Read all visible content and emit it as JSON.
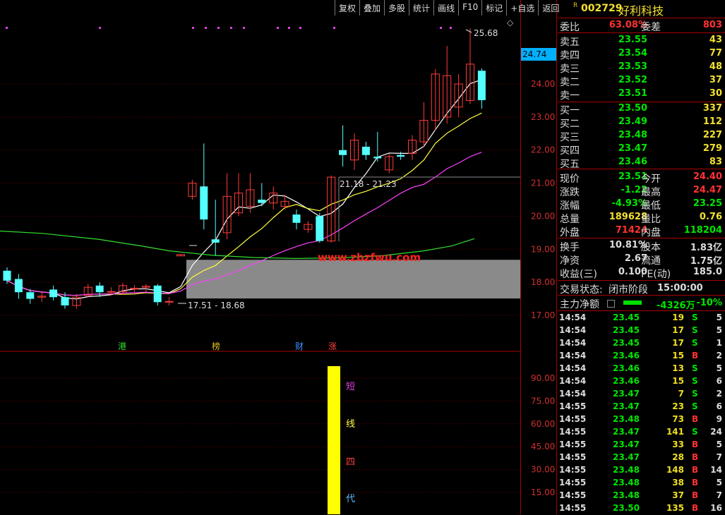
{
  "toolbar": {
    "items": [
      "复权",
      "叠加",
      "多股",
      "统计",
      "画线",
      "F10",
      "标记",
      "+自选",
      "返回"
    ]
  },
  "symbol": {
    "r_mark": "R",
    "code": "002729",
    "name": "好利科技"
  },
  "orderbook": {
    "weibi_label": "委比",
    "weibi_value": "63.08%",
    "weicha_label": "委差",
    "weicha_value": "803",
    "asks": [
      {
        "label": "卖五",
        "price": "23.55",
        "vol": "43"
      },
      {
        "label": "卖四",
        "price": "23.54",
        "vol": "77"
      },
      {
        "label": "卖三",
        "price": "23.53",
        "vol": "48"
      },
      {
        "label": "卖二",
        "price": "23.52",
        "vol": "37"
      },
      {
        "label": "卖一",
        "price": "23.51",
        "vol": "30"
      }
    ],
    "bids": [
      {
        "label": "买一",
        "price": "23.50",
        "vol": "337"
      },
      {
        "label": "买二",
        "price": "23.49",
        "vol": "112"
      },
      {
        "label": "买三",
        "price": "23.48",
        "vol": "227"
      },
      {
        "label": "买四",
        "price": "23.47",
        "vol": "279"
      },
      {
        "label": "买五",
        "price": "23.46",
        "vol": "83"
      }
    ]
  },
  "quote": [
    {
      "l1": "现价",
      "v1": "23.51",
      "c1": "green",
      "l2": "今开",
      "v2": "24.40",
      "c2": "red"
    },
    {
      "l1": "涨跌",
      "v1": "-1.22",
      "c1": "green",
      "l2": "最高",
      "v2": "24.47",
      "c2": "red"
    },
    {
      "l1": "涨幅",
      "v1": "-4.93%",
      "c1": "green",
      "l2": "最低",
      "v2": "23.25",
      "c2": "green"
    },
    {
      "l1": "总量",
      "v1": "189628",
      "c1": "yellow",
      "l2": "量比",
      "v2": "0.76",
      "c2": "yellow"
    },
    {
      "l1": "外盘",
      "v1": "71424",
      "c1": "red",
      "l2": "内盘",
      "v2": "118204",
      "c2": "green"
    }
  ],
  "fundamentals": [
    {
      "l1": "换手",
      "v1": "10.81%",
      "l2": "股本",
      "v2": "1.83亿"
    },
    {
      "l1": "净资",
      "v1": "2.67",
      "l2": "流通",
      "v2": "1.75亿"
    },
    {
      "l1": "收益(三)",
      "v1": "0.100",
      "l2": "PE(动)",
      "v2": "185.0"
    }
  ],
  "status": {
    "label": "交易状态:",
    "value": "闭市阶段",
    "time": "15:00:00"
  },
  "main_force": {
    "label": "主力净额",
    "amount": "-4326万",
    "pct": "-10%"
  },
  "ticks": [
    {
      "time": "14:54",
      "price": "23.45",
      "vol": "19",
      "side": "S",
      "cnt": "5"
    },
    {
      "time": "14:54",
      "price": "23.45",
      "vol": "17",
      "side": "S",
      "cnt": "5"
    },
    {
      "time": "14:54",
      "price": "23.45",
      "vol": "17",
      "side": "S",
      "cnt": "1"
    },
    {
      "time": "14:54",
      "price": "23.46",
      "vol": "15",
      "side": "B",
      "cnt": "2"
    },
    {
      "time": "14:54",
      "price": "23.46",
      "vol": "13",
      "side": "S",
      "cnt": "5"
    },
    {
      "time": "14:54",
      "price": "23.46",
      "vol": "15",
      "side": "S",
      "cnt": "6"
    },
    {
      "time": "14:54",
      "price": "23.47",
      "vol": "7",
      "side": "S",
      "cnt": "2"
    },
    {
      "time": "14:55",
      "price": "23.47",
      "vol": "23",
      "side": "S",
      "cnt": "6"
    },
    {
      "time": "14:55",
      "price": "23.48",
      "vol": "73",
      "side": "B",
      "cnt": "9"
    },
    {
      "time": "14:55",
      "price": "23.47",
      "vol": "141",
      "side": "S",
      "cnt": "24"
    },
    {
      "time": "14:55",
      "price": "23.47",
      "vol": "33",
      "side": "B",
      "cnt": "5"
    },
    {
      "time": "14:55",
      "price": "23.47",
      "vol": "28",
      "side": "B",
      "cnt": "7"
    },
    {
      "time": "14:55",
      "price": "23.48",
      "vol": "148",
      "side": "B",
      "cnt": "14"
    },
    {
      "time": "14:55",
      "price": "23.48",
      "vol": "38",
      "side": "B",
      "cnt": "5"
    },
    {
      "time": "14:55",
      "price": "23.48",
      "vol": "37",
      "side": "B",
      "cnt": "7"
    },
    {
      "time": "14:55",
      "price": "23.50",
      "vol": "135",
      "side": "B",
      "cnt": "16"
    }
  ],
  "chart_data": {
    "type": "candlestick",
    "price_axis": {
      "ticks": [
        "24.00",
        "23.00",
        "22.00",
        "21.00",
        "20.00",
        "19.00",
        "18.00",
        "17.00"
      ],
      "current_tag": "24.74"
    },
    "annotations": {
      "high": "25.68",
      "box_upper": "21.18 - 21.23",
      "box_lower": "17.51 - 18.68",
      "watermark": "www.zbzfwu.com"
    },
    "event_markers": [
      "港",
      "榜",
      "财",
      "涨"
    ],
    "indicator": {
      "ticks": [
        "90.00",
        "75.00",
        "60.00",
        "45.00",
        "30.00",
        "15.00"
      ],
      "labels": [
        "短",
        "线",
        "四",
        "代"
      ]
    },
    "candles": [
      {
        "o": 18.35,
        "c": 18.05,
        "h": 18.45,
        "l": 17.95
      },
      {
        "o": 18.1,
        "c": 17.7,
        "h": 18.25,
        "l": 17.5
      },
      {
        "o": 17.7,
        "c": 17.5,
        "h": 17.8,
        "l": 17.35
      },
      {
        "o": 17.55,
        "c": 17.58,
        "h": 17.7,
        "l": 17.4
      },
      {
        "o": 17.78,
        "c": 17.55,
        "h": 17.9,
        "l": 17.45
      },
      {
        "o": 17.55,
        "c": 17.3,
        "h": 17.7,
        "l": 17.2
      },
      {
        "o": 17.3,
        "c": 17.55,
        "h": 17.65,
        "l": 17.2
      },
      {
        "o": 17.6,
        "c": 17.85,
        "h": 17.95,
        "l": 17.55
      },
      {
        "o": 17.9,
        "c": 17.7,
        "h": 18.0,
        "l": 17.55
      },
      {
        "o": 17.7,
        "c": 17.72,
        "h": 17.85,
        "l": 17.6
      },
      {
        "o": 17.72,
        "c": 17.9,
        "h": 17.98,
        "l": 17.62
      },
      {
        "o": 17.8,
        "c": 17.82,
        "h": 17.92,
        "l": 17.7
      },
      {
        "o": 17.85,
        "c": 17.88,
        "h": 17.95,
        "l": 17.7
      },
      {
        "o": 17.9,
        "c": 17.4,
        "h": 17.95,
        "l": 17.3
      },
      {
        "o": 17.4,
        "c": 17.42,
        "h": 17.55,
        "l": 17.3
      },
      {
        "o": 18.8,
        "c": 18.84,
        "h": 18.84,
        "l": 18.8
      },
      {
        "o": 20.6,
        "c": 21.0,
        "h": 21.1,
        "l": 20.5
      },
      {
        "o": 20.9,
        "c": 19.9,
        "h": 22.2,
        "l": 19.6
      },
      {
        "o": 19.3,
        "c": 19.2,
        "h": 20.5,
        "l": 18.8
      },
      {
        "o": 19.5,
        "c": 20.6,
        "h": 21.3,
        "l": 19.3
      },
      {
        "o": 20.1,
        "c": 20.7,
        "h": 21.3,
        "l": 20.0
      },
      {
        "o": 20.3,
        "c": 20.8,
        "h": 21.3,
        "l": 20.1
      },
      {
        "o": 20.5,
        "c": 20.4,
        "h": 21.0,
        "l": 20.3
      },
      {
        "o": 20.4,
        "c": 20.7,
        "h": 20.9,
        "l": 20.2
      },
      {
        "o": 20.3,
        "c": 20.45,
        "h": 20.65,
        "l": 20.2
      },
      {
        "o": 20.05,
        "c": 19.8,
        "h": 20.2,
        "l": 19.6
      },
      {
        "o": 19.6,
        "c": 19.75,
        "h": 19.85,
        "l": 19.5
      },
      {
        "o": 20.0,
        "c": 19.25,
        "h": 20.1,
        "l": 19.2
      },
      {
        "o": 19.25,
        "c": 21.18,
        "h": 21.23,
        "l": 19.2
      },
      {
        "o": 22.0,
        "c": 21.85,
        "h": 22.75,
        "l": 21.5
      },
      {
        "o": 21.7,
        "c": 22.3,
        "h": 22.5,
        "l": 21.4
      },
      {
        "o": 22.1,
        "c": 21.85,
        "h": 22.25,
        "l": 21.7
      },
      {
        "o": 21.8,
        "c": 21.75,
        "h": 22.55,
        "l": 21.65
      },
      {
        "o": 21.4,
        "c": 21.8,
        "h": 21.9,
        "l": 21.3
      },
      {
        "o": 21.85,
        "c": 21.8,
        "h": 21.95,
        "l": 21.7
      },
      {
        "o": 21.9,
        "c": 22.3,
        "h": 22.45,
        "l": 21.7
      },
      {
        "o": 22.25,
        "c": 22.9,
        "h": 23.45,
        "l": 22.1
      },
      {
        "o": 22.9,
        "c": 24.3,
        "h": 24.45,
        "l": 22.6
      },
      {
        "o": 23.0,
        "c": 24.25,
        "h": 25.15,
        "l": 22.8
      },
      {
        "o": 23.3,
        "c": 24.0,
        "h": 24.3,
        "l": 23.0
      },
      {
        "o": 23.5,
        "c": 24.6,
        "h": 25.68,
        "l": 23.4
      },
      {
        "o": 24.4,
        "c": 23.51,
        "h": 24.47,
        "l": 23.25
      }
    ]
  }
}
